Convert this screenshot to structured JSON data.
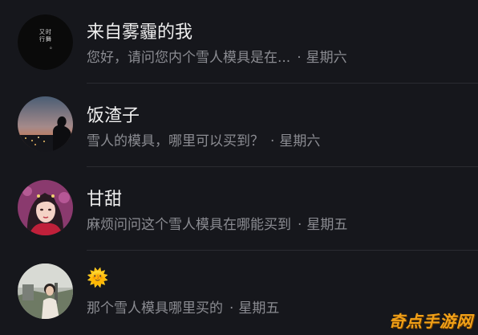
{
  "conversations": [
    {
      "name": "来自雾霾的我",
      "avatar": {
        "icon": "calligraphy-avatar",
        "lines": [
          "又",
          "时",
          "行",
          "舞",
          "。"
        ]
      },
      "message": "您好，请问您内个雪人模具是在...",
      "separator": "·",
      "time": "星期六"
    },
    {
      "name": "饭渣子",
      "avatar": {
        "icon": "city-night-silhouette-avatar"
      },
      "message": "雪人的模具，哪里可以买到？",
      "separator": "·",
      "time": "星期六"
    },
    {
      "name": "甘甜",
      "avatar": {
        "icon": "girl-portrait-avatar"
      },
      "message": "麻烦问问这个雪人模具在哪能买到",
      "separator": "·",
      "time": "星期五"
    },
    {
      "name": "🌞",
      "avatar": {
        "icon": "outdoor-person-avatar"
      },
      "message": "那个雪人模具哪里买的",
      "separator": "·",
      "time": "星期五"
    }
  ],
  "watermark": "奇点手游网"
}
